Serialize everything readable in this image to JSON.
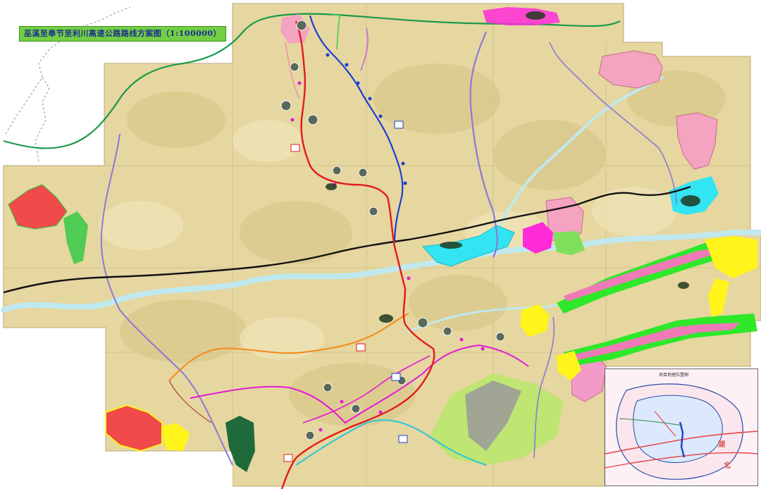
{
  "title": "巫溪至奉节至利川高速公路路线方案图（1:100000）",
  "inset": {
    "title": "项目地理位置图",
    "label_hu": "湖",
    "label_bei": "北"
  },
  "colors": {
    "mainline_red": "#e21b1b",
    "alt_blue": "#1c3fd1",
    "connector_magenta": "#e21bd6",
    "connector_orange": "#f28a1a",
    "connector_cyan": "#2bc6d8",
    "border_green": "#1a9a4a",
    "expressway_black": "#111111",
    "road_purple": "#8a7ad8",
    "river": "#bfe9ef",
    "terrain": "#e8d9a3"
  }
}
